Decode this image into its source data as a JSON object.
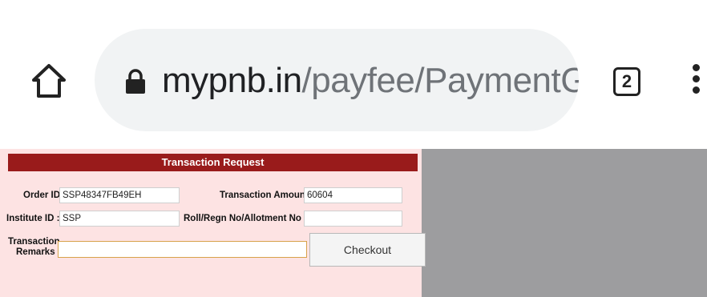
{
  "browser": {
    "url_host": "mypnb.in",
    "url_path": "/payfee/PaymentGate",
    "tab_count": "2",
    "icons": {
      "home": "home-icon",
      "lock": "lock-icon",
      "menu": "more-vert-icon"
    }
  },
  "form": {
    "title": "Transaction Request",
    "order_id_label": "Order ID :",
    "order_id_value": "SSP48347FB49EH",
    "transaction_amount_label": "Transaction Amount :",
    "transaction_amount_value": "60604",
    "institute_id_label": "Institute ID :",
    "institute_id_value": "SSP",
    "roll_label": "Roll/Regn No/Allotment No :",
    "roll_value": "",
    "remarks_label_line1": "Transaction",
    "remarks_label_line2": "Remarks :",
    "remarks_value": "",
    "checkout_label": "Checkout"
  },
  "colors": {
    "header_bg": "#991b1b",
    "panel_bg": "#fde3e3",
    "page_bg": "#9d9d9f",
    "omnibox_bg": "#f1f3f4"
  }
}
